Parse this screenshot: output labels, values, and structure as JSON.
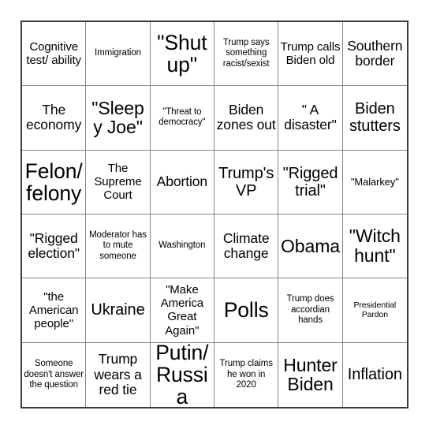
{
  "card": {
    "type": "bingo-card",
    "rows": 6,
    "columns": 6,
    "background_color": "#ffffff",
    "text_color": "#000000",
    "outer_border_color": "#3b3b3b",
    "inner_border_color": "#858585",
    "cells": [
      {
        "text": "Cognitive test/ ability",
        "size": "m"
      },
      {
        "text": "Immigration",
        "size": "xs"
      },
      {
        "text": "\"Shut up\"",
        "size": "h"
      },
      {
        "text": "Trump says something racist/sexist",
        "size": "xs"
      },
      {
        "text": "Trump calls Biden old",
        "size": "m"
      },
      {
        "text": "Southern border",
        "size": "l"
      },
      {
        "text": "The economy",
        "size": "l"
      },
      {
        "text": "\"Sleepy Joe\"",
        "size": "xxl"
      },
      {
        "text": "\"Threat to democracy\"",
        "size": "xs"
      },
      {
        "text": "Biden zones out",
        "size": "l"
      },
      {
        "text": "\" A disaster\"",
        "size": "l"
      },
      {
        "text": "Biden stutters",
        "size": "xl"
      },
      {
        "text": "Felon/ felony",
        "size": "h"
      },
      {
        "text": "The Supreme Court",
        "size": "m"
      },
      {
        "text": "Abortion",
        "size": "l"
      },
      {
        "text": "Trump's VP",
        "size": "xl"
      },
      {
        "text": "\"Rigged trial\"",
        "size": "xl"
      },
      {
        "text": "\"Malarkey\"",
        "size": "s"
      },
      {
        "text": "\"Rigged election\"",
        "size": "l"
      },
      {
        "text": "Moderator has to mute someone",
        "size": "xs"
      },
      {
        "text": "Washington",
        "size": "xs"
      },
      {
        "text": "Climate change",
        "size": "l"
      },
      {
        "text": "Obama",
        "size": "xxl"
      },
      {
        "text": "\"Witch hunt\"",
        "size": "xxl"
      },
      {
        "text": "\"the American people\"",
        "size": "m"
      },
      {
        "text": "Ukraine",
        "size": "xl"
      },
      {
        "text": "\"Make America Great Again\"",
        "size": "m"
      },
      {
        "text": "Polls",
        "size": "h"
      },
      {
        "text": "Trump does accordian hands",
        "size": "xs"
      },
      {
        "text": "Presidential Pardon",
        "size": "xxs"
      },
      {
        "text": "Someone doesn't answer the question",
        "size": "xs"
      },
      {
        "text": "Trump wears a red tie",
        "size": "l"
      },
      {
        "text": "Putin/ Russia",
        "size": "h"
      },
      {
        "text": "Trump claims he won in 2020",
        "size": "xs"
      },
      {
        "text": "Hunter Biden",
        "size": "xxl"
      },
      {
        "text": "Inflation",
        "size": "xl"
      }
    ]
  }
}
